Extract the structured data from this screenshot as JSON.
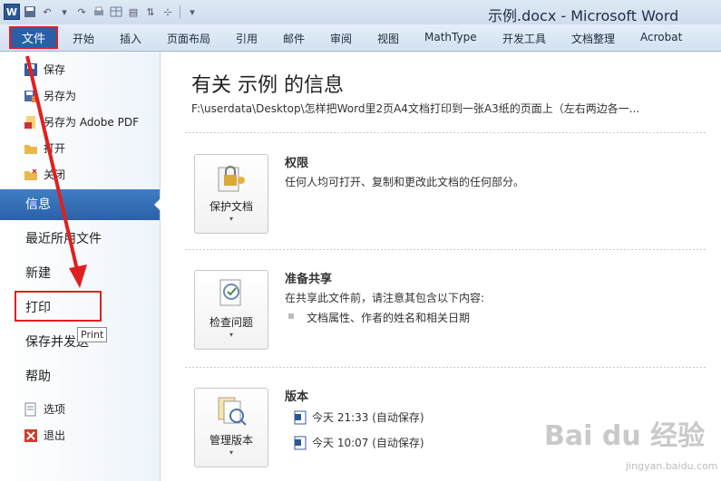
{
  "window": {
    "title": "示例.docx - Microsoft Word"
  },
  "qat": {
    "icons": [
      "word-logo-icon",
      "save-icon",
      "undo-icon",
      "redo-icon",
      "print-preview-icon",
      "table-icon",
      "sort-icon",
      "more-icon"
    ],
    "word_logo": "W"
  },
  "ribbon": {
    "file_tab": "文件",
    "tabs": [
      "开始",
      "插入",
      "页面布局",
      "引用",
      "邮件",
      "审阅",
      "视图",
      "MathType",
      "开发工具",
      "文档整理",
      "Acrobat"
    ]
  },
  "left_pane": {
    "small_items": [
      "保存",
      "另存为",
      "另存为 Adobe PDF",
      "打开",
      "关闭"
    ],
    "big_items": [
      "信息",
      "最近所用文件",
      "新建",
      "打印",
      "保存并发送",
      "帮助"
    ],
    "bottom_items": [
      "选项",
      "退出"
    ],
    "active": "信息",
    "tooltip": "Print"
  },
  "info": {
    "title": "有关 示例 的信息",
    "path": "F:\\userdata\\Desktop\\怎样把Word里2页A4文档打印到一张A3纸的页面上（左右两边各一..."
  },
  "sections": {
    "permissions": {
      "button": "保护文档",
      "title": "权限",
      "desc": "任何人均可打开、复制和更改此文档的任何部分。"
    },
    "share": {
      "button": "检查问题",
      "title": "准备共享",
      "desc": "在共享此文件前，请注意其包含以下内容:",
      "bullet": "文档属性、作者的姓名和相关日期"
    },
    "versions": {
      "button": "管理版本",
      "title": "版本",
      "items": [
        "今天 21:33 (自动保存)",
        "今天 10:07 (自动保存)"
      ]
    }
  },
  "watermark": {
    "main": "Bai du 经验",
    "sub": "jingyan.baidu.com"
  },
  "colors": {
    "accent": "#2b61a8",
    "annotation": "#e02020"
  }
}
